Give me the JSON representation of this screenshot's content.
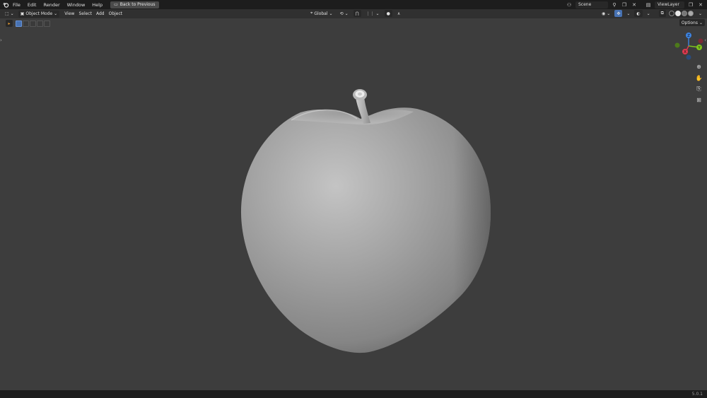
{
  "menubar": {
    "items": [
      "File",
      "Edit",
      "Render",
      "Window",
      "Help"
    ],
    "back_button": "Back to Previous",
    "scene": "Scene",
    "view_layer": "ViewLayer"
  },
  "viewport_header": {
    "mode": "Object Mode",
    "menus": [
      "View",
      "Select",
      "Add",
      "Object"
    ],
    "transform_orientation": "Global"
  },
  "tool_settings": {
    "options_label": "Options"
  },
  "gizmo": {
    "x": "X",
    "y": "Y",
    "z": "Z",
    "colors": {
      "x": "#e03a4f",
      "y": "#7fc41c",
      "z": "#3d84e3"
    }
  },
  "statusbar": {
    "version": "5.0.1"
  }
}
